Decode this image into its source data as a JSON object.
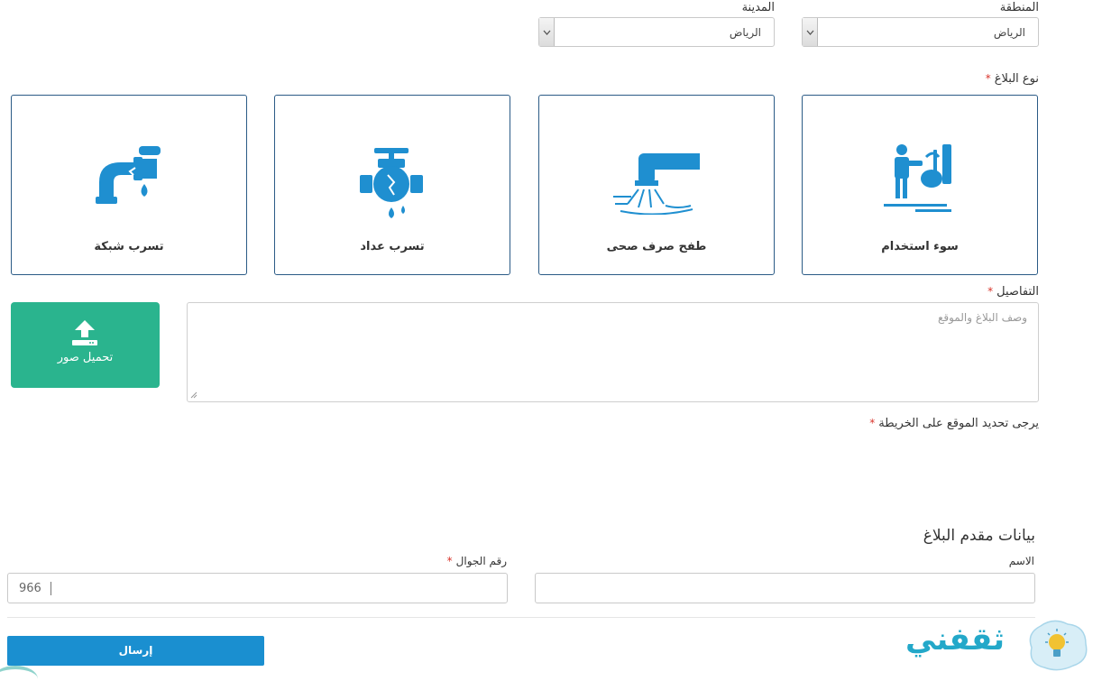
{
  "location": {
    "region_label": "المنطقة",
    "region_value": "الرياض",
    "city_label": "المدينة",
    "city_value": "الرياض"
  },
  "report_type": {
    "label": "نوع البلاغ",
    "required_mark": "*",
    "options": [
      {
        "label": "سوء استخدام",
        "icon": "misuse-icon"
      },
      {
        "label": "طفح صرف صحى",
        "icon": "sewage-overflow-icon"
      },
      {
        "label": "تسرب عداد",
        "icon": "meter-leak-icon"
      },
      {
        "label": "تسرب شبكة",
        "icon": "network-leak-icon"
      }
    ]
  },
  "details": {
    "label": "التفاصيل",
    "required_mark": "*",
    "placeholder": "وصف البلاغ والموقع"
  },
  "upload": {
    "label": "تحميل صور",
    "icon": "upload-icon"
  },
  "map": {
    "label": "يرجى تحديد الموقع على الخريطة",
    "required_mark": "*"
  },
  "reporter": {
    "heading": "بيانات مقدم البلاغ",
    "name_label": "الاسم",
    "phone_label": "رقم الجوال",
    "phone_required_mark": "*",
    "phone_prefix": "966"
  },
  "submit_label": "إرسال",
  "watermark": {
    "text": "ثقفني",
    "icon": "lightbulb-icon"
  },
  "colors": {
    "card_border": "#2b5b86",
    "icon_blue": "#1f8fd0",
    "upload_green": "#2ab48e",
    "submit_blue": "#1a8fd0",
    "required_red": "#d9342b"
  }
}
